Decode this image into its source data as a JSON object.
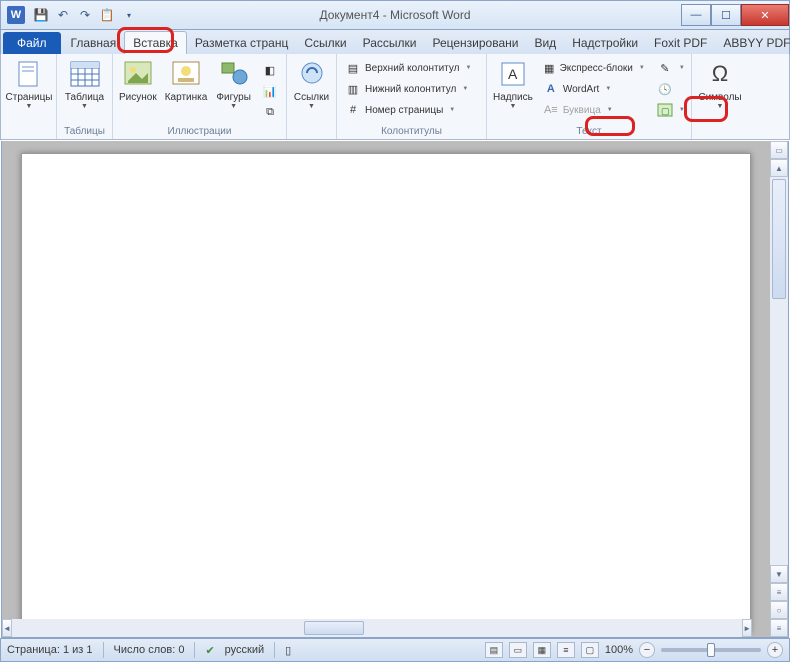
{
  "titlebar": {
    "title": "Документ4 - Microsoft Word",
    "app_letter": "W"
  },
  "tabs": {
    "file": "Файл",
    "items": [
      "Главная",
      "Вставка",
      "Разметка странц",
      "Ссылки",
      "Рассылки",
      "Рецензировани",
      "Вид",
      "Надстройки",
      "Foxit PDF",
      "ABBYY PDF Trans"
    ],
    "active_index": 1
  },
  "ribbon": {
    "pages": {
      "btn": "Страницы",
      "group": ""
    },
    "tables": {
      "btn": "Таблица",
      "group": "Таблицы"
    },
    "illus": {
      "picture": "Рисунок",
      "clip": "Картинка",
      "shapes": "Фигуры",
      "group": "Иллюстрации"
    },
    "links": {
      "btn": "Ссылки"
    },
    "hf": {
      "header": "Верхний колонтитул",
      "footer": "Нижний колонтитул",
      "pagenum": "Номер страницы",
      "group": "Колонтитулы"
    },
    "text": {
      "textbox": "Надпись",
      "quick": "Экспресс-блоки",
      "wordart": "WordArt",
      "dropcap": "Буквица",
      "group": "Текст"
    },
    "symbols": {
      "btn": "Символы"
    }
  },
  "status": {
    "page": "Страница: 1 из 1",
    "words": "Число слов: 0",
    "lang": "русский",
    "zoom": "100%"
  }
}
